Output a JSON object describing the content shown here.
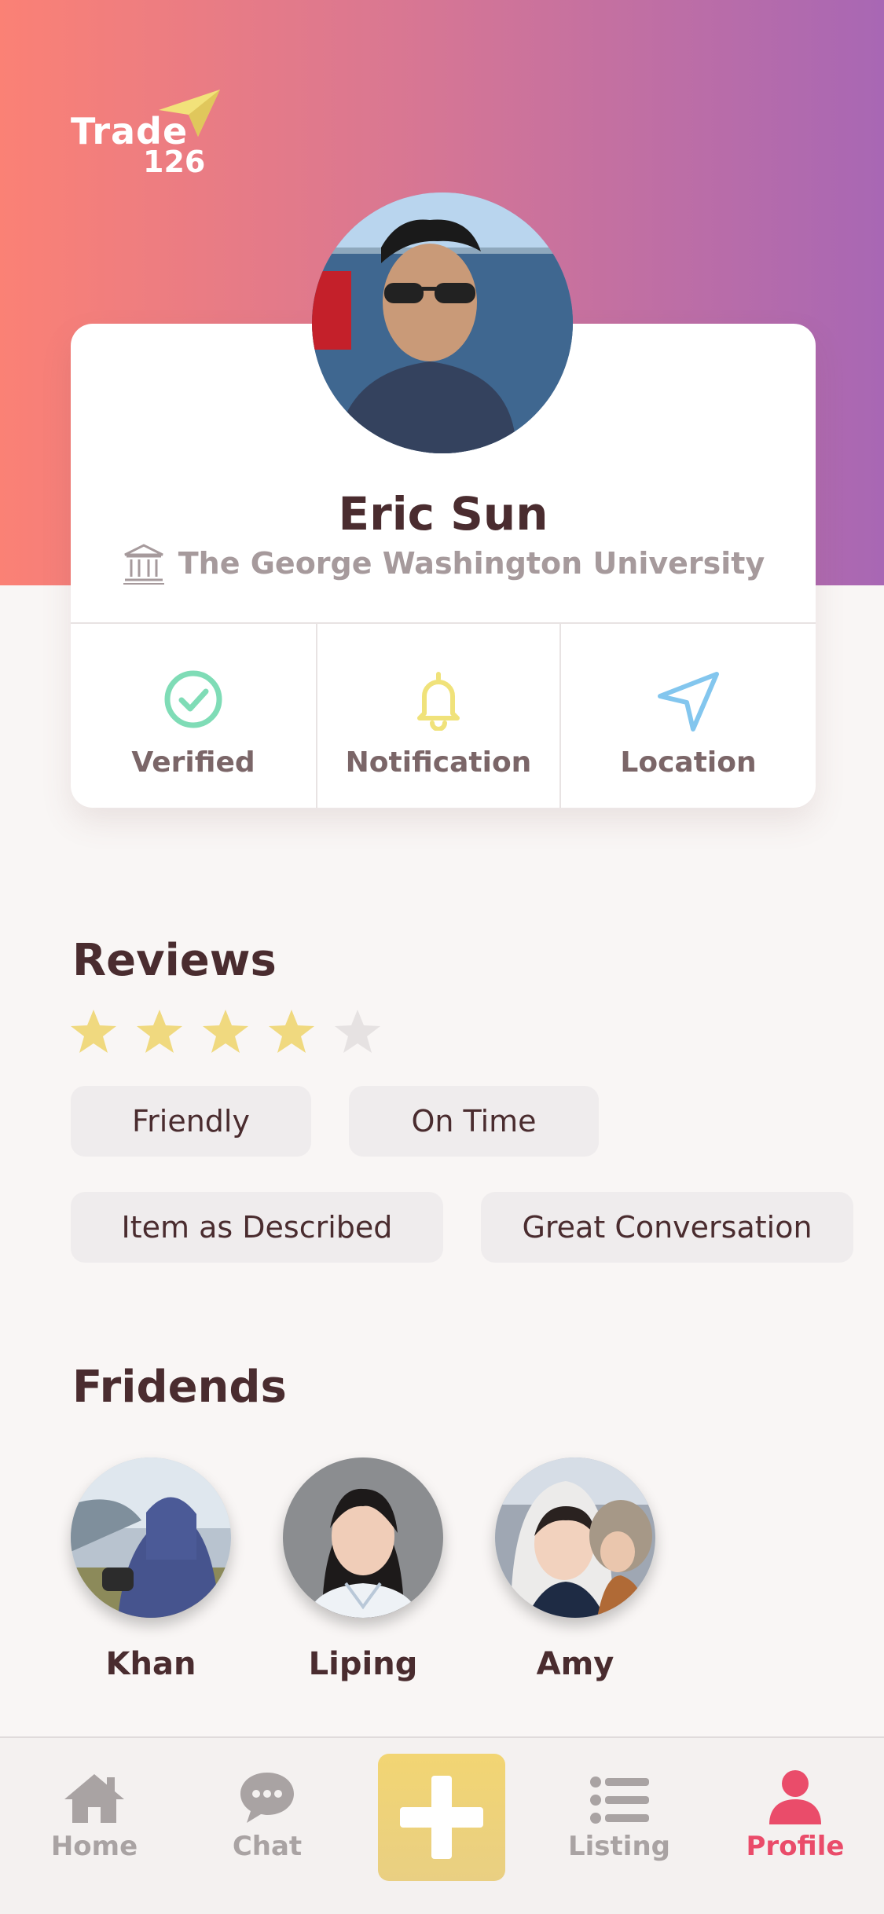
{
  "brand": {
    "logo_line1": "Trade",
    "logo_line2": "126"
  },
  "profile": {
    "name": "Eric Sun",
    "school": "The George Washington University",
    "status": [
      {
        "label": "Verified",
        "icon": "check-circle-icon",
        "color": "#7fdcb6"
      },
      {
        "label": "Notification",
        "icon": "bell-icon",
        "color": "#f0e27a"
      },
      {
        "label": "Location",
        "icon": "navigation-arrow-icon",
        "color": "#83c6ee"
      }
    ]
  },
  "reviews": {
    "title": "Reviews",
    "rating": 4,
    "max_rating": 5,
    "tags": [
      "Friendly",
      "On Time",
      "Item as Described",
      "Great Conversation"
    ]
  },
  "friends": {
    "title": "Fridends",
    "items": [
      {
        "name": "Khan"
      },
      {
        "name": "Liping"
      },
      {
        "name": "Amy"
      }
    ]
  },
  "tabbar": {
    "items": [
      {
        "label": "Home",
        "icon": "home-icon"
      },
      {
        "label": "Chat",
        "icon": "chat-icon"
      },
      {
        "label": "",
        "icon": "plus-icon"
      },
      {
        "label": "Listing",
        "icon": "list-icon"
      },
      {
        "label": "Profile",
        "icon": "person-icon"
      }
    ],
    "active": "Profile"
  },
  "colors": {
    "gradient_start": "#fb8175",
    "gradient_end": "#a867b4",
    "accent_pink": "#ea4c6a",
    "star_filled": "#f0d97f",
    "star_empty": "#e6e2e2",
    "add_button": "#eed57c"
  }
}
